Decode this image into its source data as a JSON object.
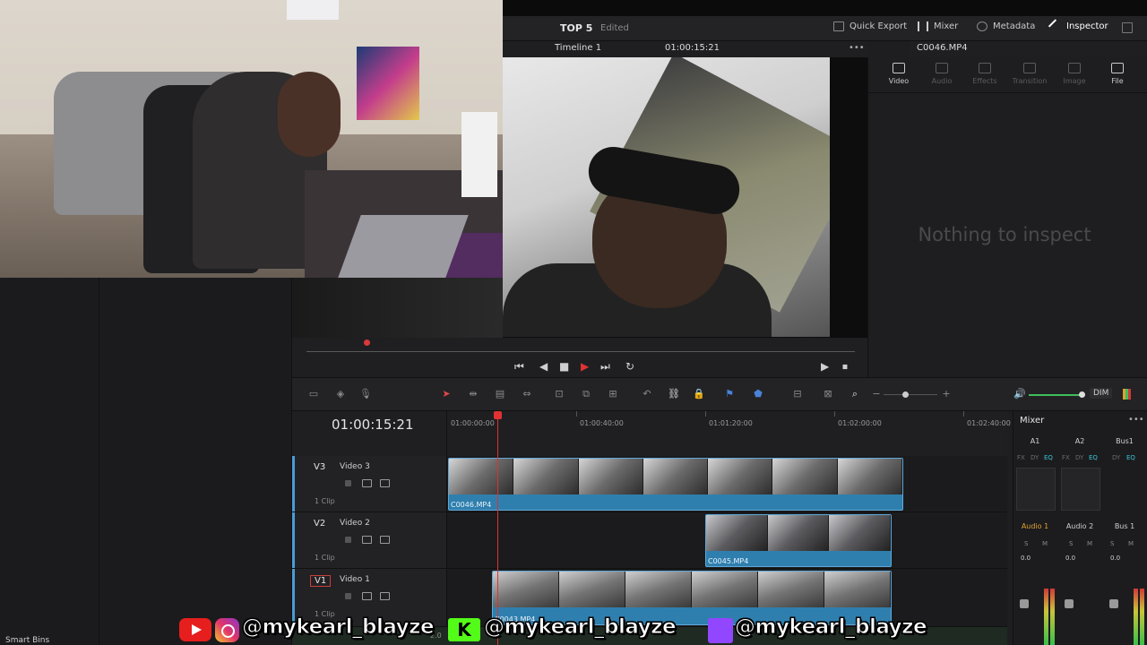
{
  "header": {
    "project_title": "TOP 5",
    "project_status": "Edited",
    "quick_export": "Quick Export",
    "mixer": "Mixer",
    "metadata": "Metadata",
    "inspector": "Inspector"
  },
  "viewer": {
    "timeline_name": "Timeline 1",
    "timecode": "01:00:15:21"
  },
  "inspector": {
    "clip_name": "C0046.MP4",
    "tabs": [
      "Video",
      "Audio",
      "Effects",
      "Transition",
      "Image",
      "File"
    ],
    "empty_message": "Nothing to inspect"
  },
  "timeline": {
    "timecode": "01:00:15:21",
    "ruler_labels": [
      "01:00:00:00",
      "01:00:40:00",
      "01:01:20:00",
      "01:02:00:00",
      "01:02:40:00"
    ],
    "tracks": [
      {
        "id": "V3",
        "name": "Video 3",
        "clips": "1 Clip"
      },
      {
        "id": "V2",
        "name": "Video 2",
        "clips": "1 Clip"
      },
      {
        "id": "V1",
        "name": "Video 1",
        "clips": "1 Clip"
      }
    ],
    "clip_labels": {
      "v3": "C0046.MP4",
      "v2": "C0045.MP4",
      "v1": "C0043.MP4"
    },
    "frame_label": "2.0"
  },
  "toolbar": {
    "dim": "DIM"
  },
  "mixer": {
    "title": "Mixer",
    "channels": [
      "A1",
      "A2",
      "Bus1"
    ],
    "fx_row": [
      "FX",
      "DY",
      "EQ",
      "FX",
      "DY",
      "EQ",
      "DY",
      "EQ"
    ],
    "names": [
      "Audio 1",
      "Audio 2",
      "Bus 1"
    ],
    "values": [
      "0.0",
      "0.0",
      "0.0"
    ],
    "sm": [
      "S",
      "M",
      "S",
      "M",
      "S",
      "M"
    ]
  },
  "left_panel": {
    "smart_bins": "Smart Bins"
  },
  "social": {
    "handle_1": "@mykearl_blayze",
    "handle_2": "@mykearl_blayze",
    "handle_3": "@mykearl_blayze",
    "kick_letter": "K"
  },
  "colors": {
    "accent_red": "#e03232",
    "clip_blue": "#2f7fae",
    "eq_cyan": "#36c5d8"
  }
}
